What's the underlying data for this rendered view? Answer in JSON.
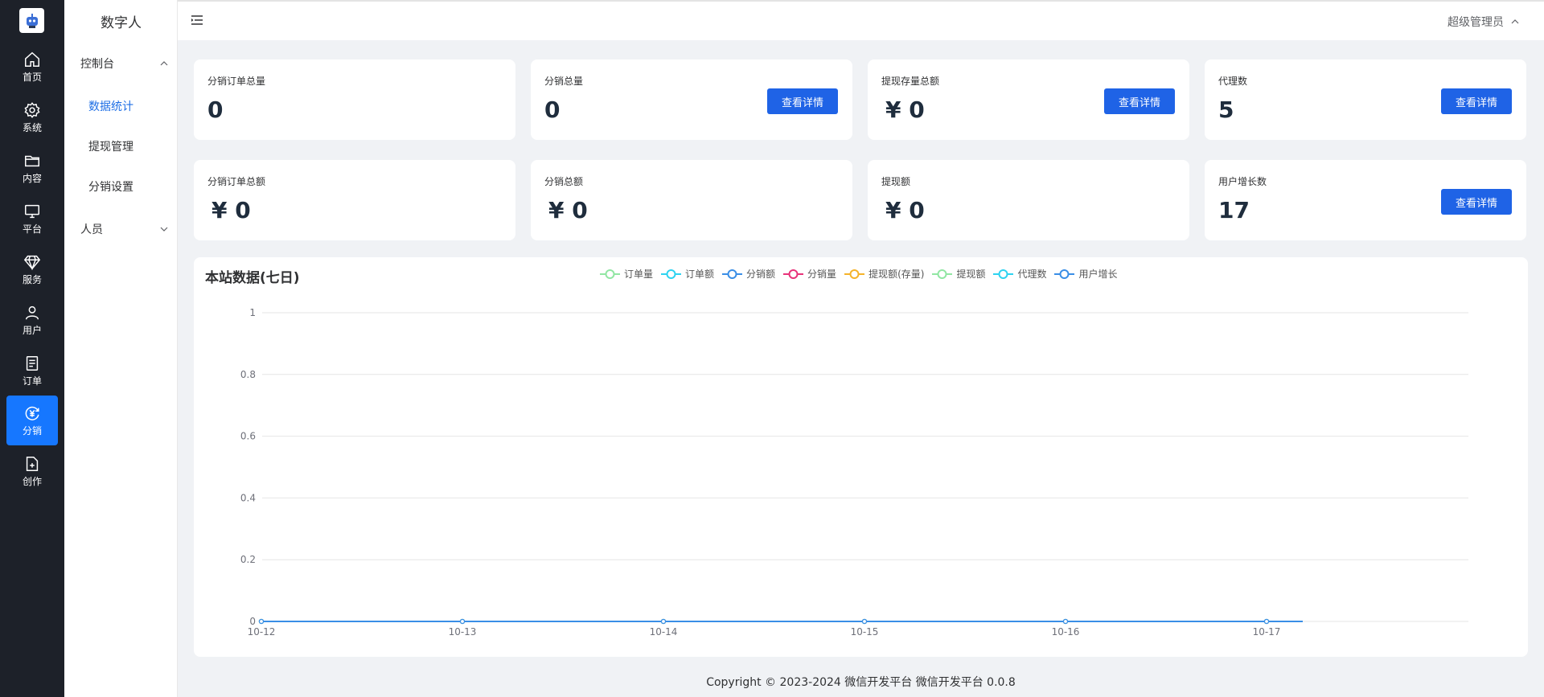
{
  "rail": {
    "items": [
      {
        "label": "首页",
        "icon": "home-icon"
      },
      {
        "label": "系统",
        "icon": "gear-icon"
      },
      {
        "label": "内容",
        "icon": "folder-icon"
      },
      {
        "label": "平台",
        "icon": "monitor-icon"
      },
      {
        "label": "服务",
        "icon": "diamond-icon"
      },
      {
        "label": "用户",
        "icon": "user-icon"
      },
      {
        "label": "订单",
        "icon": "order-icon"
      },
      {
        "label": "分销",
        "icon": "yuan-icon",
        "active": true
      },
      {
        "label": "创作",
        "icon": "file-add-icon"
      }
    ]
  },
  "submenu": {
    "title": "数字人",
    "group1": "控制台",
    "items": [
      "数据统计",
      "提现管理",
      "分销设置"
    ],
    "group2": "人员"
  },
  "header": {
    "user": "超级管理员"
  },
  "cards": [
    {
      "label": "分销订单总量",
      "value": "0",
      "button": ""
    },
    {
      "label": "分销总量",
      "value": "0",
      "button": "查看详情"
    },
    {
      "label": "提现存量总额",
      "value": "¥ 0",
      "button": "查看详情"
    },
    {
      "label": "代理数",
      "value": "5",
      "button": "查看详情"
    },
    {
      "label": "分销订单总额",
      "value": "¥ 0",
      "button": ""
    },
    {
      "label": "分销总额",
      "value": "¥ 0",
      "button": ""
    },
    {
      "label": "提现额",
      "value": "¥ 0",
      "button": ""
    },
    {
      "label": "用户增长数",
      "value": "17",
      "button": "查看详情"
    }
  ],
  "chart_title": "本站数据(七日)",
  "chart_data": {
    "type": "line",
    "categories": [
      "10-12",
      "10-13",
      "10-14",
      "10-15",
      "10-16",
      "10-17"
    ],
    "ylim": [
      0,
      1
    ],
    "yticks": [
      "0",
      "0.2",
      "0.4",
      "0.6",
      "0.8",
      "1"
    ],
    "grid": true,
    "legend_position": "top-center",
    "series": [
      {
        "name": "订单量",
        "color": "#91e6a3",
        "values": [
          0,
          0,
          0,
          0,
          0,
          0
        ]
      },
      {
        "name": "订单额",
        "color": "#2ed3f0",
        "values": [
          0,
          0,
          0,
          0,
          0,
          0
        ]
      },
      {
        "name": "分销额",
        "color": "#3a8ee6",
        "values": [
          0,
          0,
          0,
          0,
          0,
          0
        ]
      },
      {
        "name": "分销量",
        "color": "#e8337a",
        "values": [
          0,
          0,
          0,
          0,
          0,
          0
        ]
      },
      {
        "name": "提现额(存量)",
        "color": "#f5b32a",
        "values": [
          0,
          0,
          0,
          0,
          0,
          0
        ]
      },
      {
        "name": "提现额",
        "color": "#91e6a3",
        "values": [
          0,
          0,
          0,
          0,
          0,
          0
        ]
      },
      {
        "name": "代理数",
        "color": "#2ed3f0",
        "values": [
          0,
          0,
          0,
          0,
          0,
          0
        ]
      },
      {
        "name": "用户增长",
        "color": "#3a8ee6",
        "values": [
          0,
          0,
          0,
          0,
          0,
          0
        ]
      }
    ]
  },
  "footer": "Copyright © 2023-2024 微信开发平台  微信开发平台 0.0.8"
}
